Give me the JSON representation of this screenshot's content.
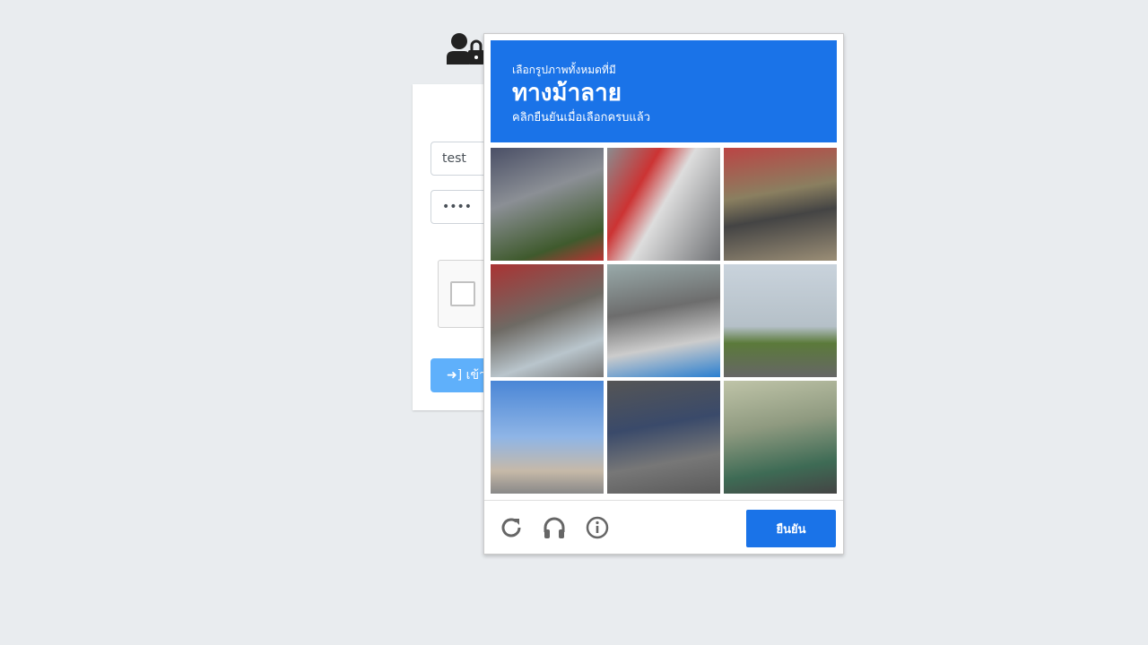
{
  "login": {
    "username": "test",
    "password": "••••",
    "submit_label": "เข้าสู่ระบบ"
  },
  "captcha": {
    "instruction": "เลือกรูปภาพทั้งหมดที่มี",
    "target": "ทางม้าลาย",
    "hint": "คลิกยืนยันเมื่อเลือกครบแล้ว",
    "verify_label": "ยืนยัน",
    "accent": "#1a73e8",
    "tiles": [
      {
        "bg": "linear-gradient(160deg,#4a4f66 0%,#8b8f95 40%,#3f5a2d 80%,#b33 100%)"
      },
      {
        "bg": "linear-gradient(120deg,#8a8c8f 0%,#c33 30%,#ddd 50%,#6f7174 100%)"
      },
      {
        "bg": "linear-gradient(170deg,#b44 0%,#8a7f60 40%,#444 60%,#9b8e76 100%)"
      },
      {
        "bg": "linear-gradient(160deg,#a33 0%,#6e6a64 45%,#b9c5cc 75%,#777 100%)"
      },
      {
        "bg": "linear-gradient(170deg,#9aa 0%,#6d6d6d 40%,#ccc 70%,#2a7fd0 100%)"
      },
      {
        "bg": "linear-gradient(180deg,#c9d3dc 0%,#b5c0c8 55%,#5b7a3a 70%,#666 100%)"
      },
      {
        "bg": "linear-gradient(180deg,#4a86d6 0%,#8fb5e6 50%,#c6b9a8 80%,#888 100%)"
      },
      {
        "bg": "linear-gradient(170deg,#555 0%,#3a4a6a 40%,#777 70%,#5a5a5a 100%)"
      },
      {
        "bg": "linear-gradient(170deg,#bfc4a8 0%,#8f9a80 40%,#3e6b55 75%,#444 100%)"
      }
    ]
  }
}
